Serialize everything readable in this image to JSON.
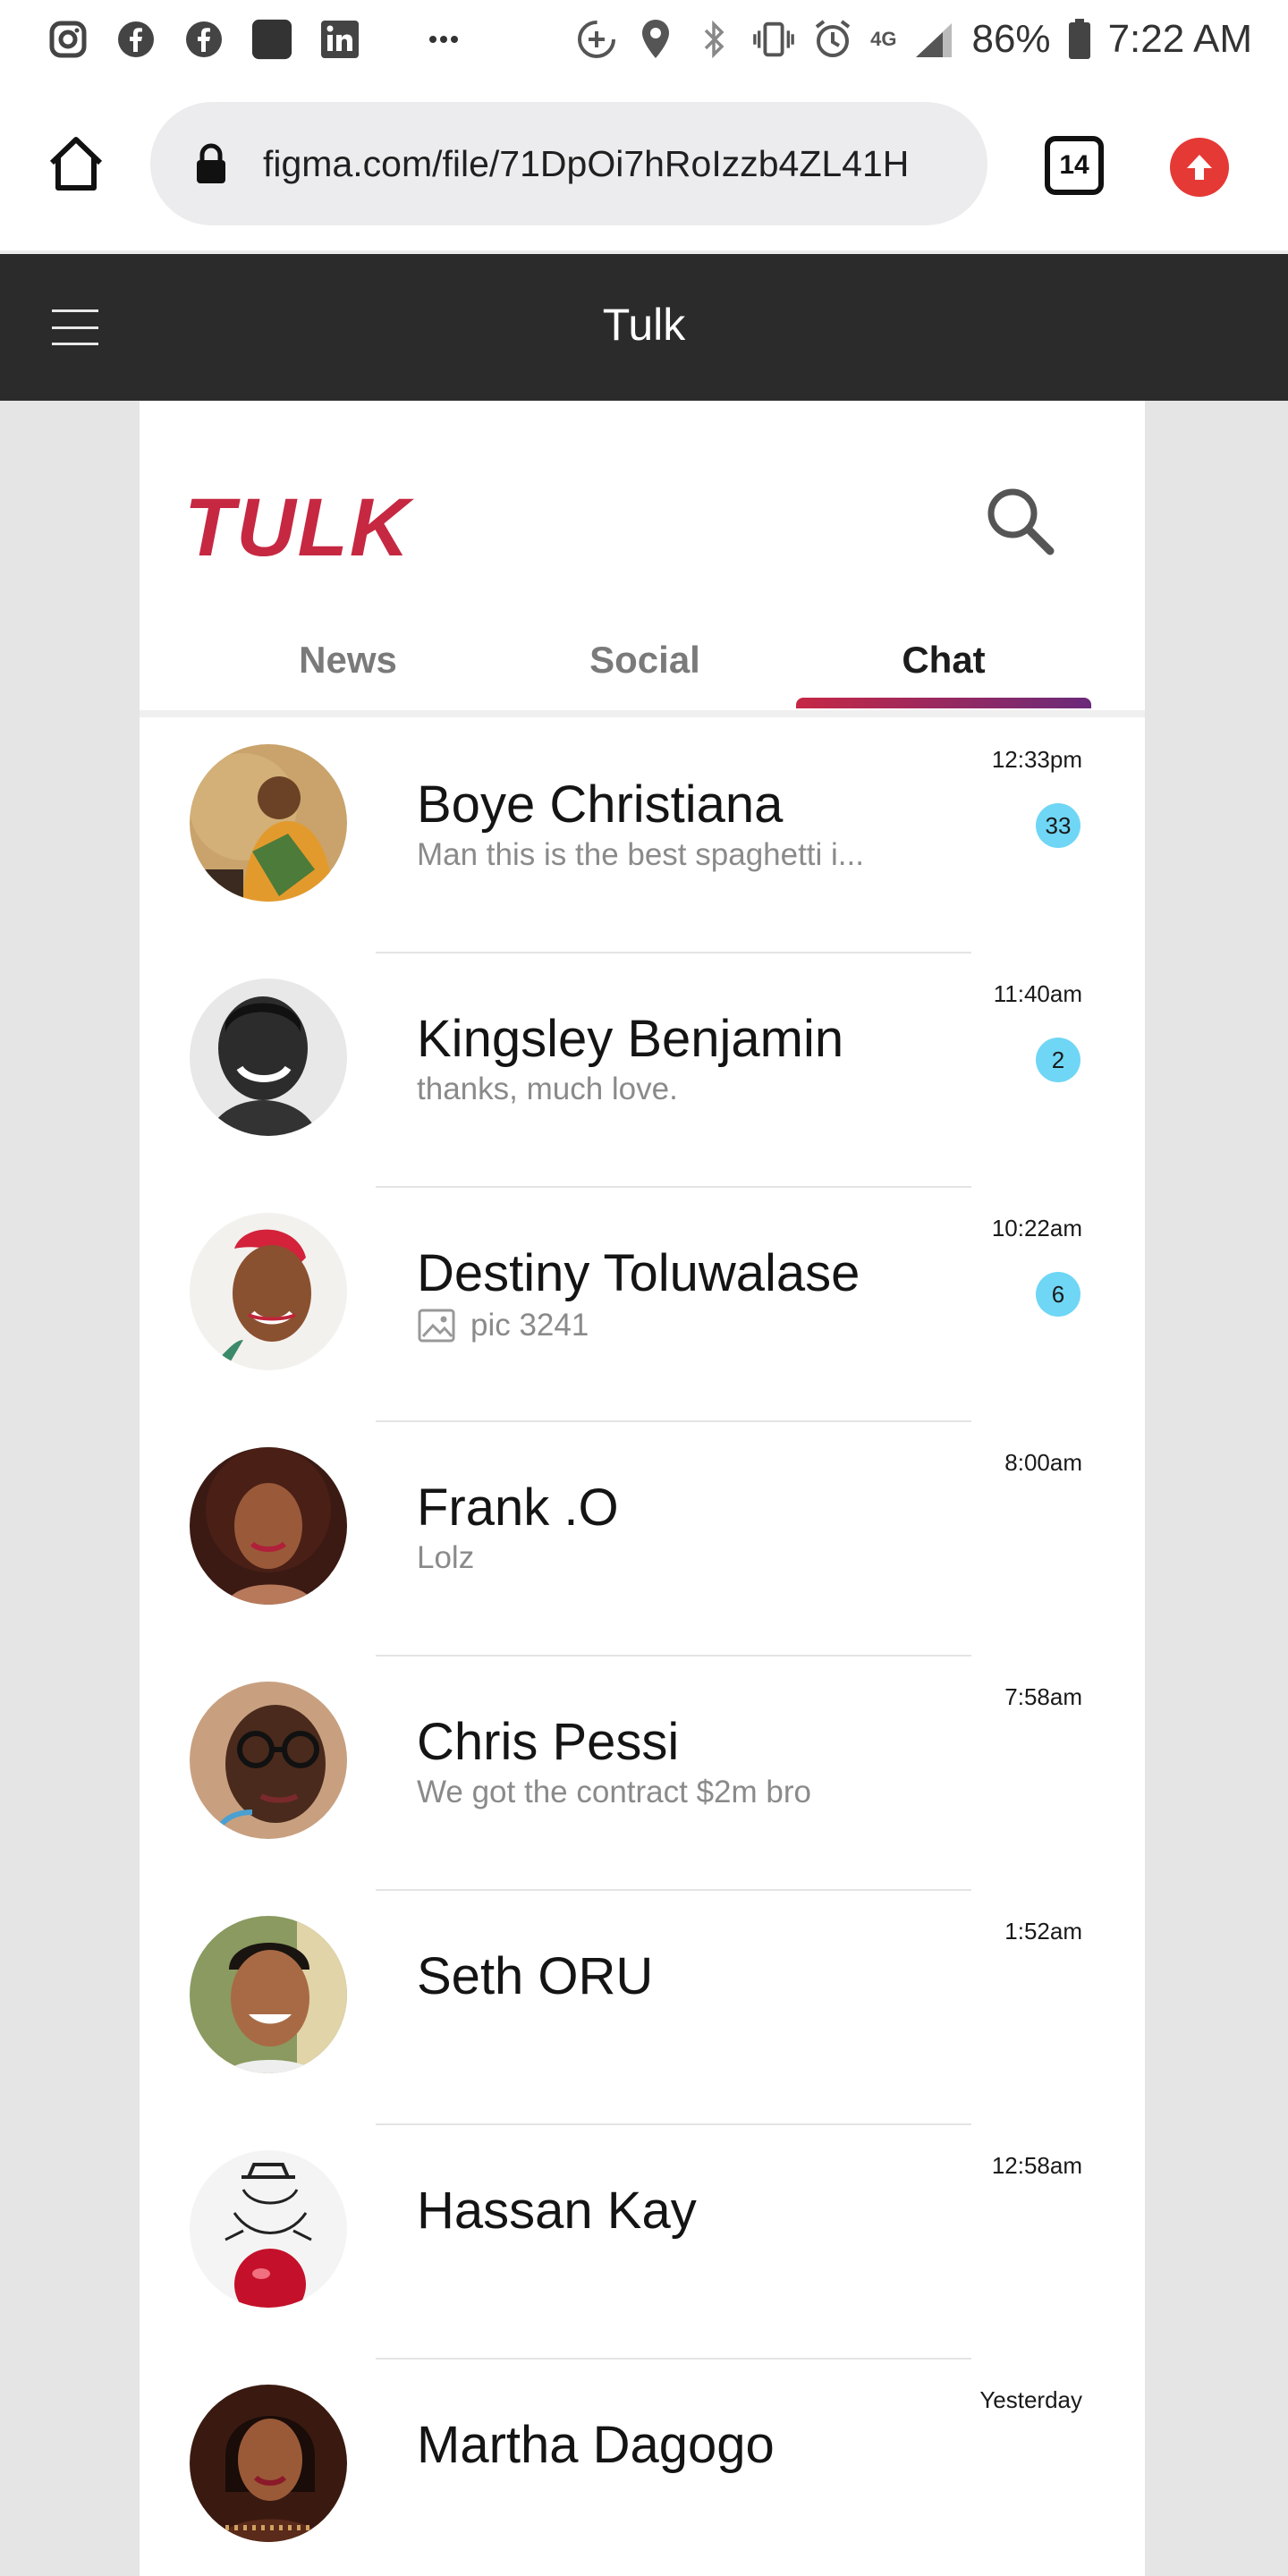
{
  "status_bar": {
    "network_label": "4G",
    "battery": "86%",
    "time": "7:22 AM"
  },
  "browser": {
    "url": "figma.com/file/71DpOi7hRoIzzb4ZL41H",
    "tab_count": "14"
  },
  "app_bar": {
    "title": "Tulk"
  },
  "app": {
    "logo": "TULK",
    "tabs": [
      {
        "label": "News"
      },
      {
        "label": "Social"
      },
      {
        "label": "Chat"
      }
    ],
    "active_tab": "Chat"
  },
  "chats": [
    {
      "name": "Boye Christiana",
      "preview": "Man this is the best spaghetti i...",
      "time": "12:33pm",
      "unread": "33"
    },
    {
      "name": "Kingsley Benjamin",
      "preview": "thanks, much love.",
      "time": "11:40am",
      "unread": "2"
    },
    {
      "name": "Destiny Toluwalase",
      "preview": "pic 3241",
      "time": "10:22am",
      "unread": "6",
      "preview_icon": "image-icon"
    },
    {
      "name": "Frank .O",
      "preview": "Lolz",
      "time": "8:00am"
    },
    {
      "name": "Chris Pessi",
      "preview": "We got the contract $2m bro",
      "time": "7:58am"
    },
    {
      "name": "Seth ORU",
      "preview": "",
      "time": "1:52am"
    },
    {
      "name": "Hassan Kay",
      "preview": "",
      "time": "12:58am"
    },
    {
      "name": "Martha Dagogo",
      "preview": "",
      "time": "Yesterday"
    }
  ],
  "colors": {
    "brand": "#c62842",
    "badge": "#6fd6f5",
    "app_bar": "#2b2b2b"
  }
}
